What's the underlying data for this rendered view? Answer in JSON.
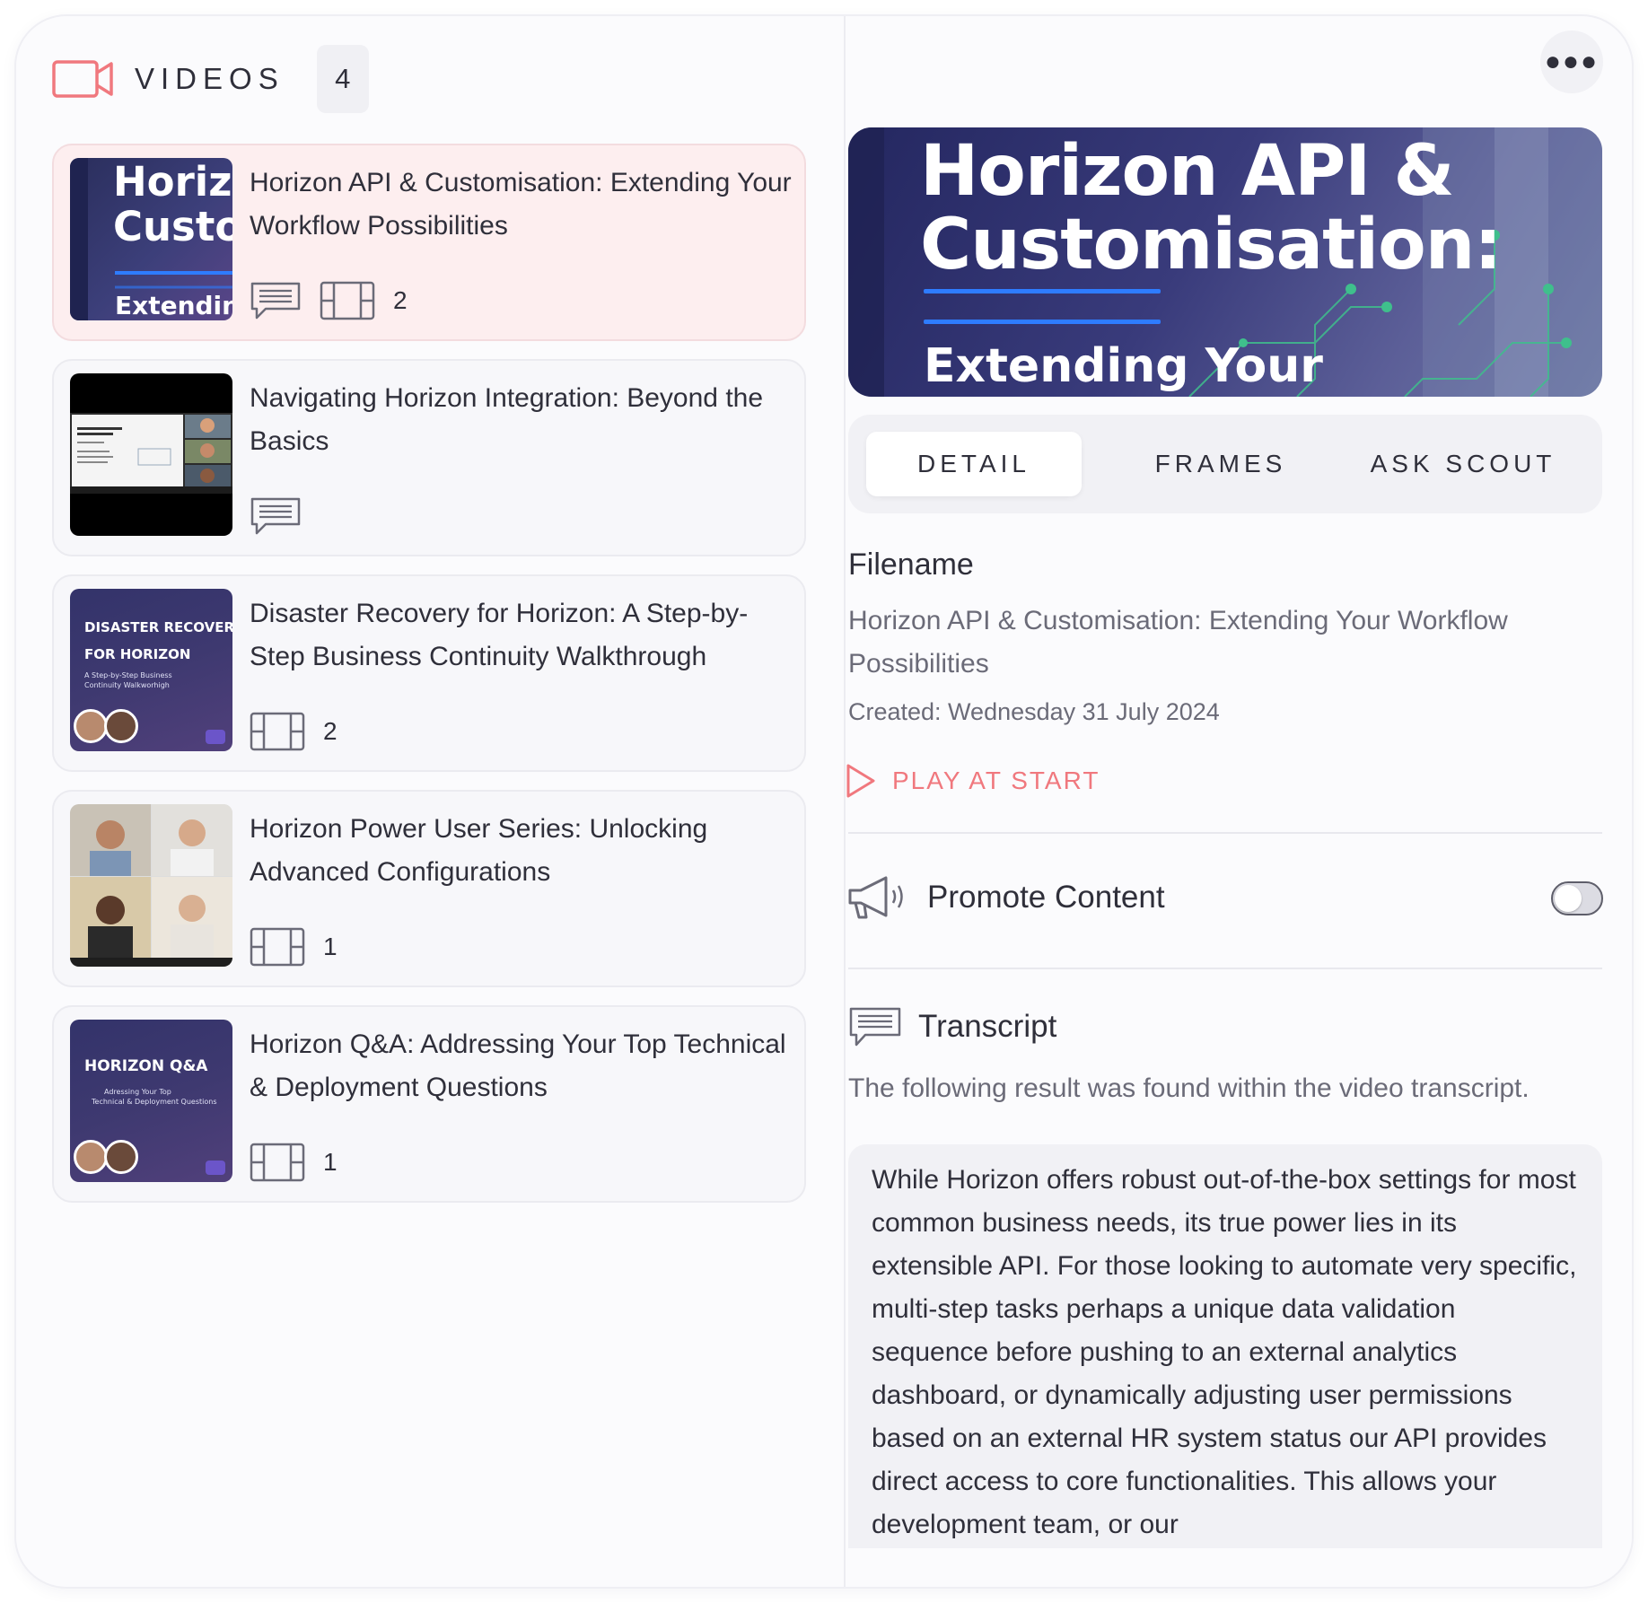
{
  "header": {
    "section_label": "VIDEOS",
    "count": "4"
  },
  "colors": {
    "accent": "#f0787e",
    "selected_item_bg": "#fdeeef",
    "hero_line": "#2e7cff"
  },
  "videos": [
    {
      "title": "Horizon API & Customisation: Extending Your Workflow Possibilities",
      "thumb_text": [
        "Horizo",
        "Custon",
        "Extending"
      ],
      "has_transcript": true,
      "has_frames": true,
      "frames_count": "2",
      "selected": true
    },
    {
      "title": "Navigating Horizon Integration: Beyond the Basics",
      "has_transcript": true,
      "has_frames": false
    },
    {
      "title": "Disaster Recovery for Horizon: A Step-by-Step Business Continuity Walkthrough",
      "thumb_text": [
        "DISASTER RECOVERY",
        "FOR HORIZON",
        "A Step-by-Step Business",
        "Continuity Walkworhigh"
      ],
      "has_transcript": false,
      "has_frames": true,
      "frames_count": "2"
    },
    {
      "title": "Horizon Power User Series: Unlocking Advanced Configurations",
      "has_transcript": false,
      "has_frames": true,
      "frames_count": "1"
    },
    {
      "title": "Horizon Q&A: Addressing Your Top Technical & Deployment Questions",
      "thumb_text": [
        "HORIZON Q&A",
        "Adressing Your Top",
        "Technical & Deployment Questions"
      ],
      "has_transcript": false,
      "has_frames": true,
      "frames_count": "1"
    }
  ],
  "detail": {
    "hero_title_line1": "Horizon API &",
    "hero_title_line2": "Customisation:",
    "hero_subtitle": "Extending Your",
    "tabs": [
      {
        "label": "DETAIL",
        "active": true
      },
      {
        "label": "FRAMES",
        "active": false
      },
      {
        "label": "ASK SCOUT",
        "active": false
      }
    ],
    "filename_label": "Filename",
    "filename_value": "Horizon API & Customisation: Extending Your Workflow Possibilities",
    "created": "Created: Wednesday 31 July 2024",
    "play_at_start": "PLAY AT START",
    "promote_label": "Promote Content",
    "promote_enabled": false,
    "transcript_title": "Transcript",
    "transcript_note": "The following result was found within the video transcript.",
    "transcript_text": "While Horizon offers robust out-of-the-box settings for most common business needs, its true power lies in its extensible API. For those looking to automate very specific, multi-step tasks perhaps a unique data validation sequence before pushing to an external analytics dashboard, or dynamically adjusting user permissions based on an external HR system status our API provides direct access to core functionalities. This allows your development team, or our"
  }
}
